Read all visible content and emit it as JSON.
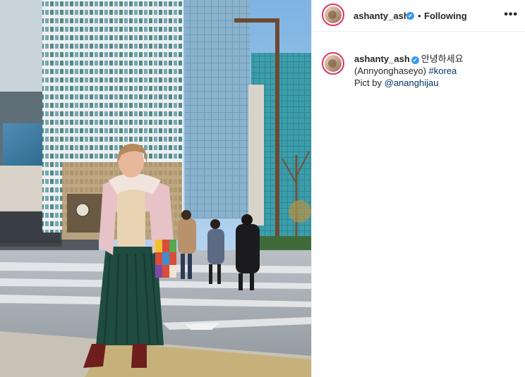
{
  "post": {
    "username": "ashanty_ash",
    "verified_mark": "✔",
    "separator": "•",
    "follow_state": "Following",
    "more_options_glyph": "•••",
    "caption": {
      "username": "ashanty_ash",
      "text_line1": "안녕하세요",
      "text_line2_plain": "(Annyonghaseyo) ",
      "hashtag": "#korea",
      "text_line3_plain": "Pict by ",
      "mention": "@ananghijau"
    }
  },
  "photo": {
    "subject": "woman in pink jacket and green pleated skirt standing on a city street crosswalk"
  },
  "icons": {
    "verified_badge": "verified-icon",
    "more_options": "more-options-icon"
  },
  "colors": {
    "link": "#003569",
    "verified": "#3897f0",
    "story_ring": "#e1306c"
  }
}
